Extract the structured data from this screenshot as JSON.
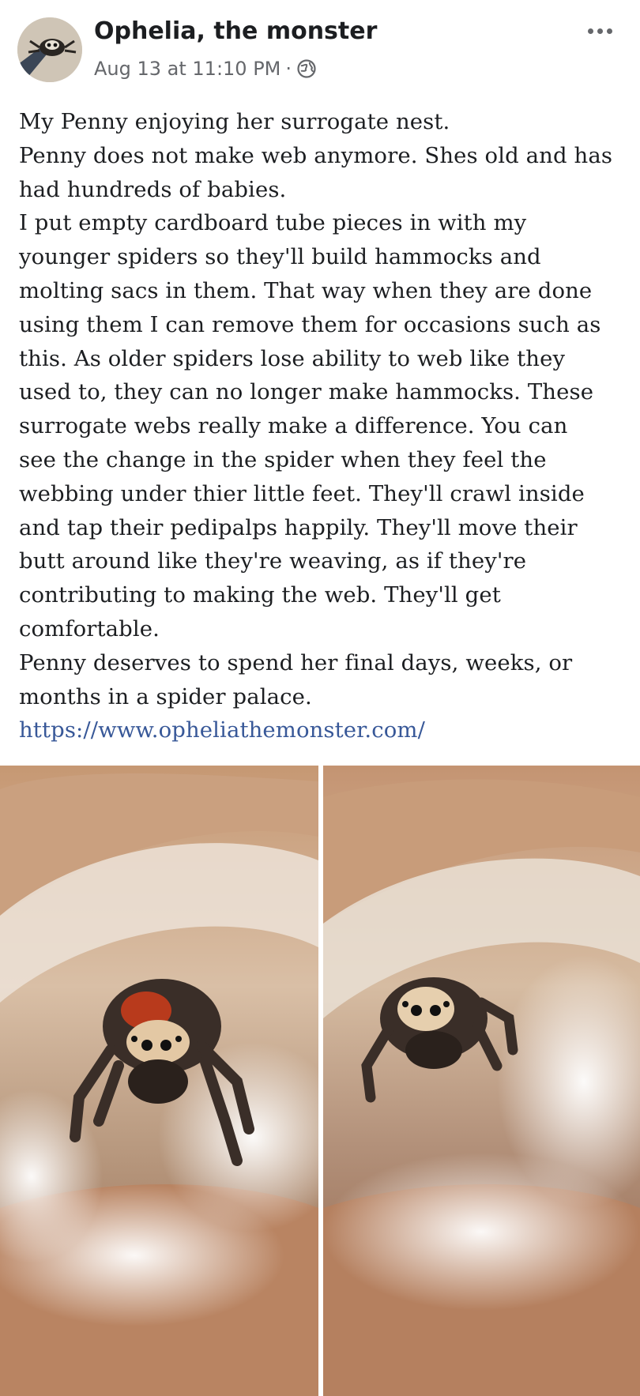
{
  "post": {
    "author": "Ophelia, the monster",
    "timestamp": "Aug 13 at 11:10 PM",
    "separator": "·",
    "privacy_icon": "globe-icon",
    "more_icon": "more-options-icon",
    "text_lines": [
      "My Penny enjoying her surrogate nest.",
      "Penny does not make web anymore.  Shes old and has",
      "had hundreds of babies.",
      "I put empty cardboard tube pieces in with my",
      "younger spiders so they'll build hammocks and",
      "molting sacs in them.  That way when they are done",
      "using them I can remove them for occasions such as",
      "this.  As older spiders lose ability to web like they",
      "used to, they can no longer make hammocks.  These",
      "surrogate webs really make a difference.  You can",
      "see the change in the spider when they feel the",
      "webbing under thier little feet.  They'll crawl inside",
      "and tap their pedipalps happily.  They'll move their",
      "butt around like they're weaving, as if they're",
      "contributing to making the web.  They'll get",
      "comfortable.",
      "Penny deserves to spend her final days, weeks, or",
      "months in a spider palace."
    ],
    "link": "https://www.opheliathemonster.com/"
  },
  "colors": {
    "text": "#1c1e21",
    "meta": "#65676b",
    "link": "#385898"
  }
}
